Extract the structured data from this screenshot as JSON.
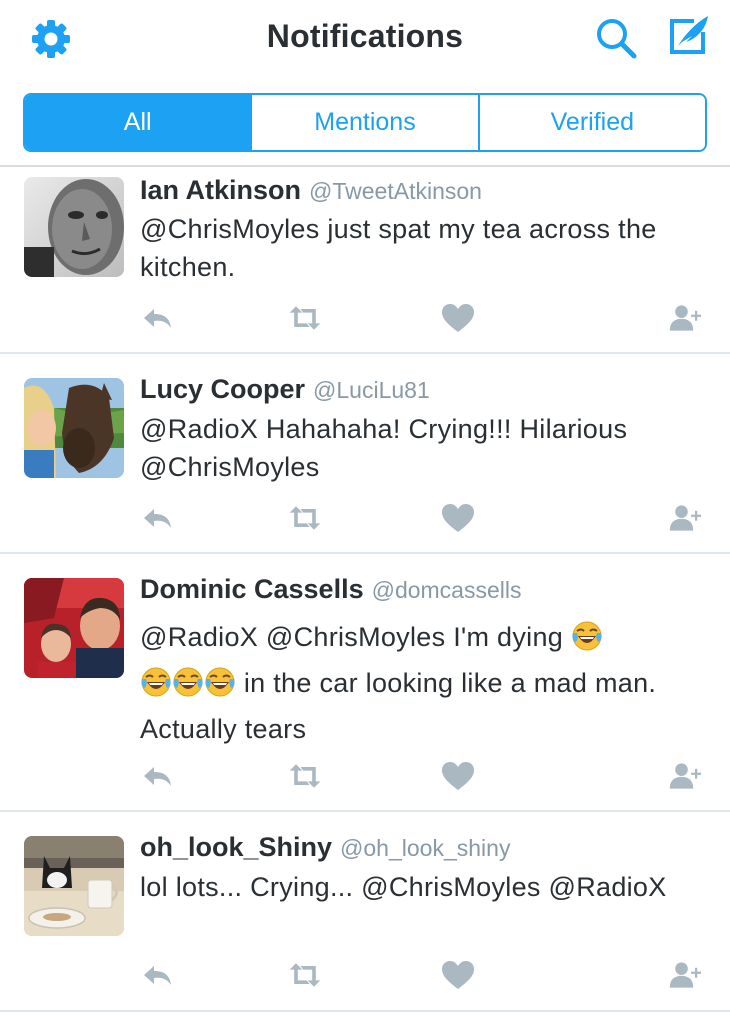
{
  "header": {
    "title": "Notifications",
    "settings_icon": "gear-icon",
    "search_icon": "search-icon",
    "compose_icon": "compose-tweet-icon"
  },
  "tabs": [
    {
      "label": "All",
      "active": true
    },
    {
      "label": "Mentions",
      "active": false
    },
    {
      "label": "Verified",
      "active": false
    }
  ],
  "colors": {
    "accent": "#1da1f2",
    "text": "#292f33",
    "muted": "#8899a6",
    "action_icon": "#aab8c2"
  },
  "tweets": [
    {
      "name": "Ian Atkinson",
      "handle": "@TweetAtkinson",
      "text": "@ChrisMoyles just spat my tea across the kitchen."
    },
    {
      "name": "Lucy Cooper",
      "handle": "@LuciLu81",
      "text": "@RadioX Hahahaha! Crying!!! Hilarious @ChrisMoyles"
    },
    {
      "name": "Dominic Cassells",
      "handle": "@domcassells",
      "text_part1": "@RadioX @ChrisMoyles I'm dying",
      "text_part2": "in the car looking like a mad man. Actually tears",
      "emoji": "face-with-tears-of-joy"
    },
    {
      "name": "oh_look_Shiny",
      "handle": "@oh_look_shiny",
      "text": "lol lots... Crying... @ChrisMoyles @RadioX"
    }
  ],
  "tweet_actions": [
    "reply-icon",
    "retweet-icon",
    "like-icon",
    "follow-icon"
  ]
}
